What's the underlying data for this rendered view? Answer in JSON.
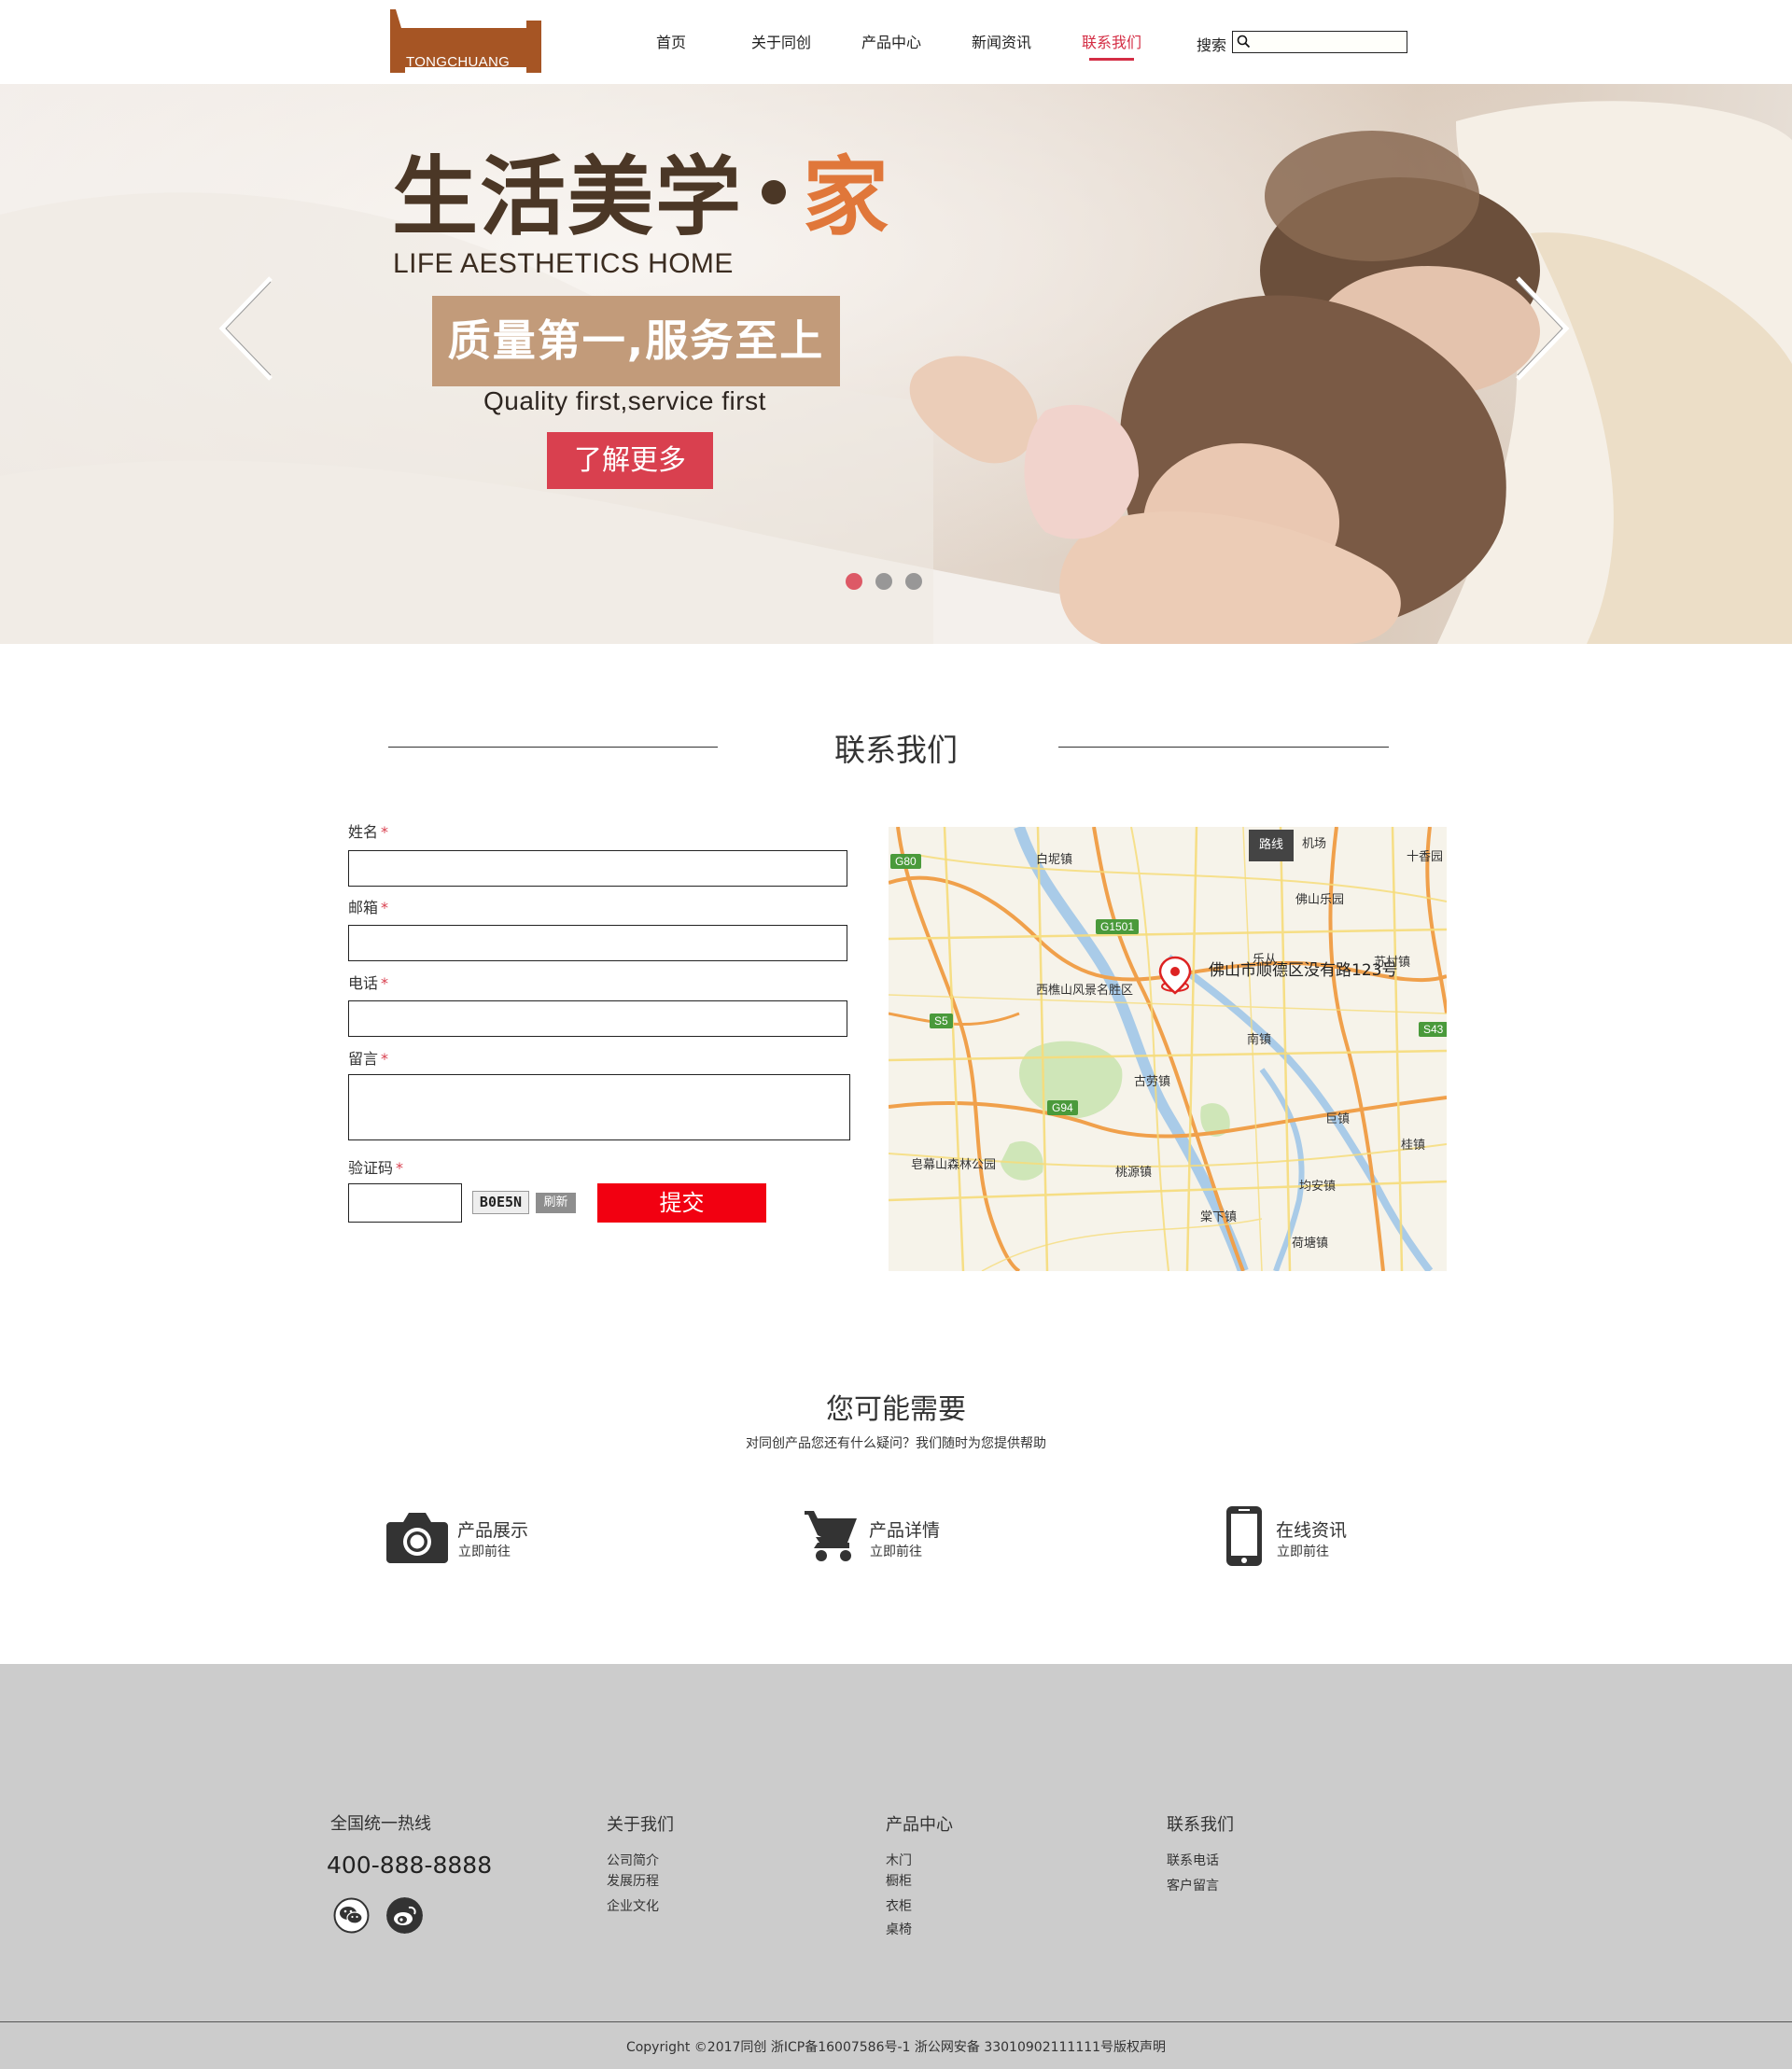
{
  "header": {
    "logo_text": "TONGCHUANG",
    "nav": [
      {
        "label": "首页"
      },
      {
        "label": "关于同创"
      },
      {
        "label": "产品中心"
      },
      {
        "label": "新闻资讯"
      },
      {
        "label": "联系我们",
        "active": true
      }
    ],
    "search_label": "搜索",
    "search_value": ""
  },
  "banner": {
    "title_main": "生活美学",
    "title_home": "家",
    "subtitle_en": "LIFE AESTHETICS HOME",
    "badge": "质量第一,服务至上",
    "quality_en": "Quality first,service first",
    "more_button": "了解更多",
    "slide_count": 3,
    "active_slide": 1,
    "accent_color": "#d9404f",
    "title_color": "#4b3726",
    "home_color": "#e0773a"
  },
  "contact": {
    "title": "联系我们",
    "fields": {
      "name_label": "姓名",
      "email_label": "邮箱",
      "phone_label": "电话",
      "message_label": "留言",
      "captcha_label": "验证码",
      "required_mark": "*"
    },
    "captcha_text": "B0E5N",
    "refresh_button": "刷新",
    "submit_button": "提交",
    "map": {
      "route_button": "路线",
      "address": "佛山市顺德区没有路123号",
      "places": {
        "baini": "白坭镇",
        "airport": "机场",
        "foshan_park": "佛山乐园",
        "xiqiao": "西樵山风景名胜区",
        "nanzhen": "南镇",
        "gulao": "古劳镇",
        "juzhen": "巨镇",
        "guizhen": "桂镇",
        "gaoming": "皂幕山森林公园",
        "taoyuan": "桃源镇",
        "junan": "均安镇",
        "xingtan": "棠下镇",
        "hetang": "荷塘镇",
        "shixiang": "十香园",
        "yuecun": "苏村镇",
        "lejiu": "乐从"
      },
      "roads": {
        "g80": "G80",
        "g1501": "G1501",
        "s5": "S5",
        "g94": "G94",
        "s43": "S43"
      }
    }
  },
  "need": {
    "title": "您可能需要",
    "subtitle": "对同创产品您还有什么疑问？我们随时为您提供帮助",
    "items": [
      {
        "title": "产品展示",
        "sub": "立即前往",
        "icon": "camera-icon"
      },
      {
        "title": "产品详情",
        "sub": "立即前往",
        "icon": "cart-icon"
      },
      {
        "title": "在线资讯",
        "sub": "立即前往",
        "icon": "phone-icon"
      }
    ]
  },
  "footer": {
    "hotline_title": "全国统一热线",
    "hotline": "400-888-8888",
    "columns": [
      {
        "title": "关于我们",
        "links": [
          "公司简介",
          "发展历程",
          "企业文化"
        ]
      },
      {
        "title": "产品中心",
        "links": [
          "木门",
          "橱柜",
          "衣柜",
          "桌椅"
        ]
      },
      {
        "title": "联系我们",
        "links": [
          "联系电话",
          "客户留言"
        ]
      }
    ],
    "copyright": "Copyright ©2017同创  浙ICP备16007586号-1  浙公网安备 33010902111111号版权声明"
  }
}
